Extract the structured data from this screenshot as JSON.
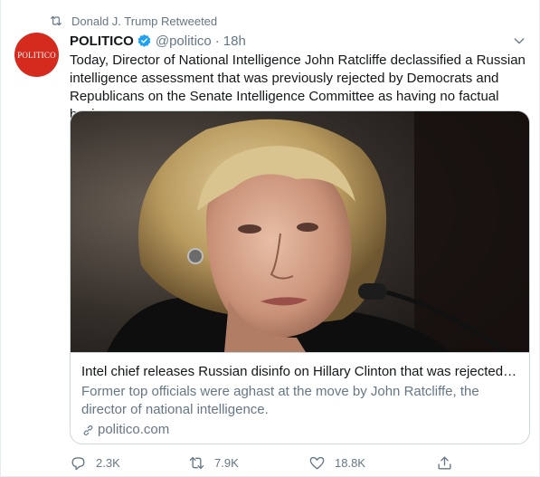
{
  "retweet_context": {
    "label": "Donald J. Trump Retweeted",
    "icon": "retweet-icon"
  },
  "author": {
    "avatar_text": "POLITICO",
    "avatar_color": "#d52b1e",
    "name": "POLITICO",
    "verified": true,
    "handle": "@politico",
    "separator": "·",
    "time": "18h"
  },
  "tweet": {
    "text": "Today, Director of National Intelligence John Ratcliffe declassified a Russian intelligence assessment that was previously rejected by Democrats and Republicans on the Senate Intelligence Committee as having no factual basis"
  },
  "card": {
    "image_subject": "photo-of-hillary-clinton-at-microphone",
    "title": "Intel chief releases Russian disinfo on Hillary Clinton that was rejected b...",
    "description": "Former top officials were aghast at the move by John Ratcliffe, the director of national intelligence.",
    "domain": "politico.com"
  },
  "actions": {
    "reply_count": "2.3K",
    "retweet_count": "7.9K",
    "like_count": "18.8K"
  },
  "colors": {
    "text_primary": "#14171a",
    "text_secondary": "#657786",
    "border": "#ccd6dd",
    "verified_blue": "#1da1f2"
  }
}
